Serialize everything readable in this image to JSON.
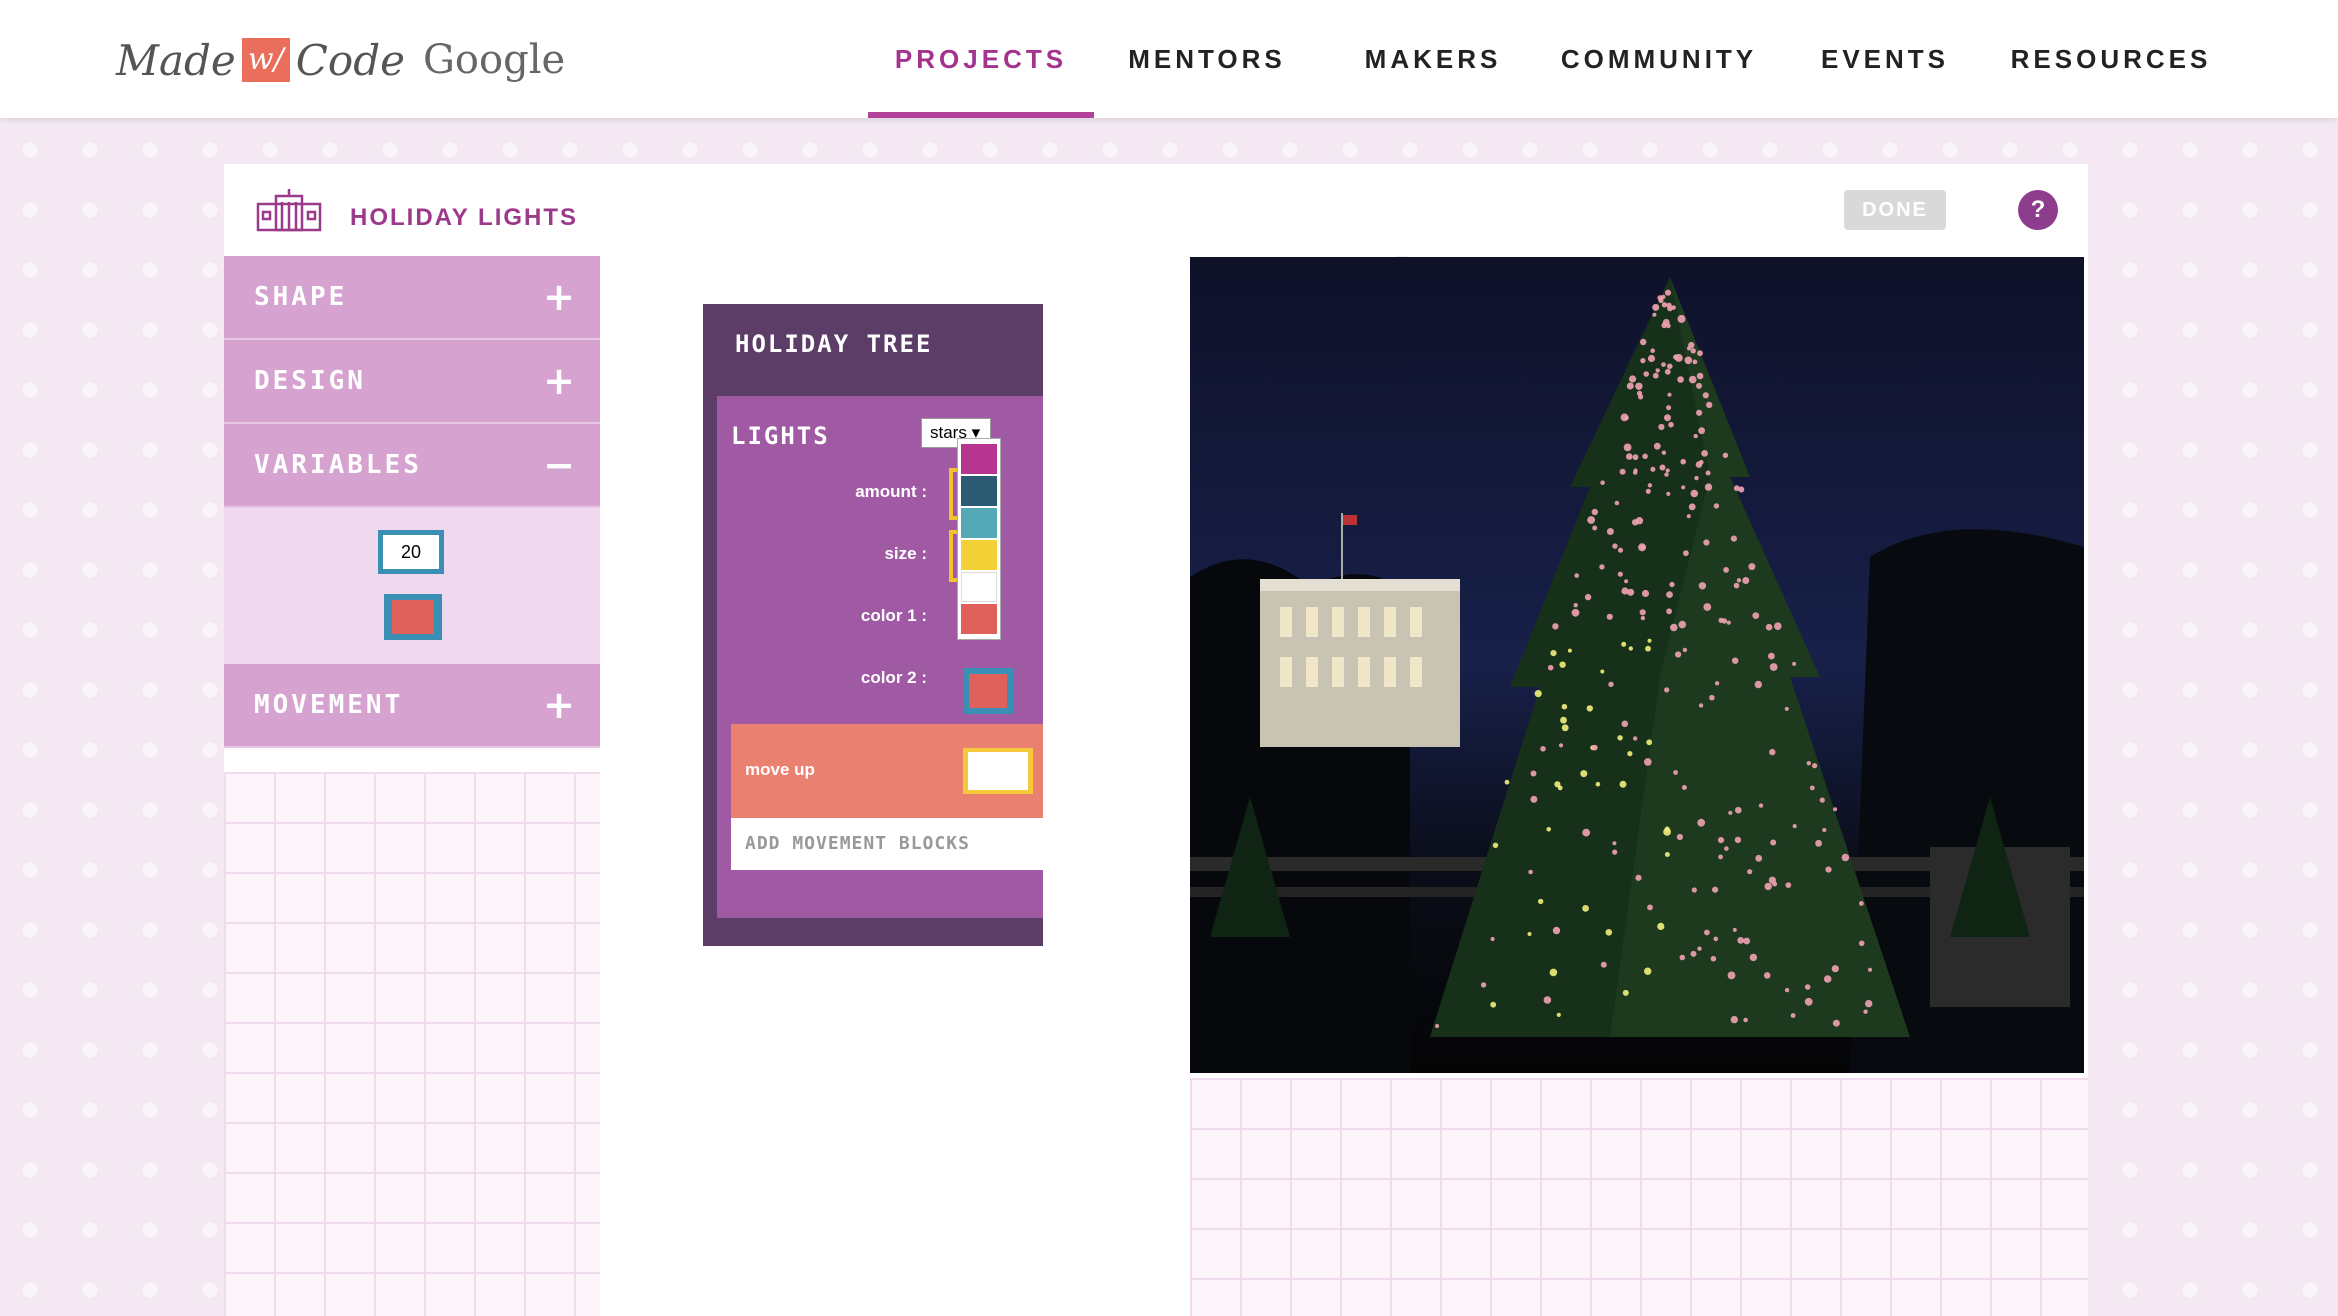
{
  "header": {
    "logo": {
      "made": "Made",
      "with": "w/",
      "code": "Code",
      "google": "Google"
    },
    "nav": [
      {
        "label": "PROJECTS",
        "active": true
      },
      {
        "label": "MENTORS",
        "active": false
      },
      {
        "label": "MAKERS",
        "active": false
      },
      {
        "label": "COMMUNITY",
        "active": false
      },
      {
        "label": "EVENTS",
        "active": false
      },
      {
        "label": "RESOURCES",
        "active": false
      }
    ]
  },
  "project": {
    "title": "HOLIDAY LIGHTS",
    "done_label": "DONE",
    "help_label": "?"
  },
  "sidebar": {
    "categories": [
      {
        "label": "SHAPE",
        "sign": "+"
      },
      {
        "label": "DESIGN",
        "sign": "+"
      },
      {
        "label": "VARIABLES",
        "sign": "−"
      },
      {
        "label": "MOVEMENT",
        "sign": "+"
      }
    ],
    "variable_number": "20"
  },
  "blocks": {
    "tree_title": "HOLIDAY TREE",
    "lights_title": "LIGHTS",
    "pattern_value": "stars",
    "params": [
      "amount :",
      "size :",
      "color 1 :",
      "color 2 :"
    ],
    "move_label": "move up",
    "add_movement": "ADD MOVEMENT BLOCKS",
    "swatch_colors": [
      "#b8358f",
      "#2d5a73",
      "#55a8b5",
      "#f2d137",
      "#ffffff",
      "#e0615b"
    ]
  },
  "colors": {
    "accent": "#b3429a",
    "category": "#d6a3d0",
    "block_purple": "#a05aa3",
    "block_dark": "#5b3d67",
    "movement": "#ea8170"
  }
}
